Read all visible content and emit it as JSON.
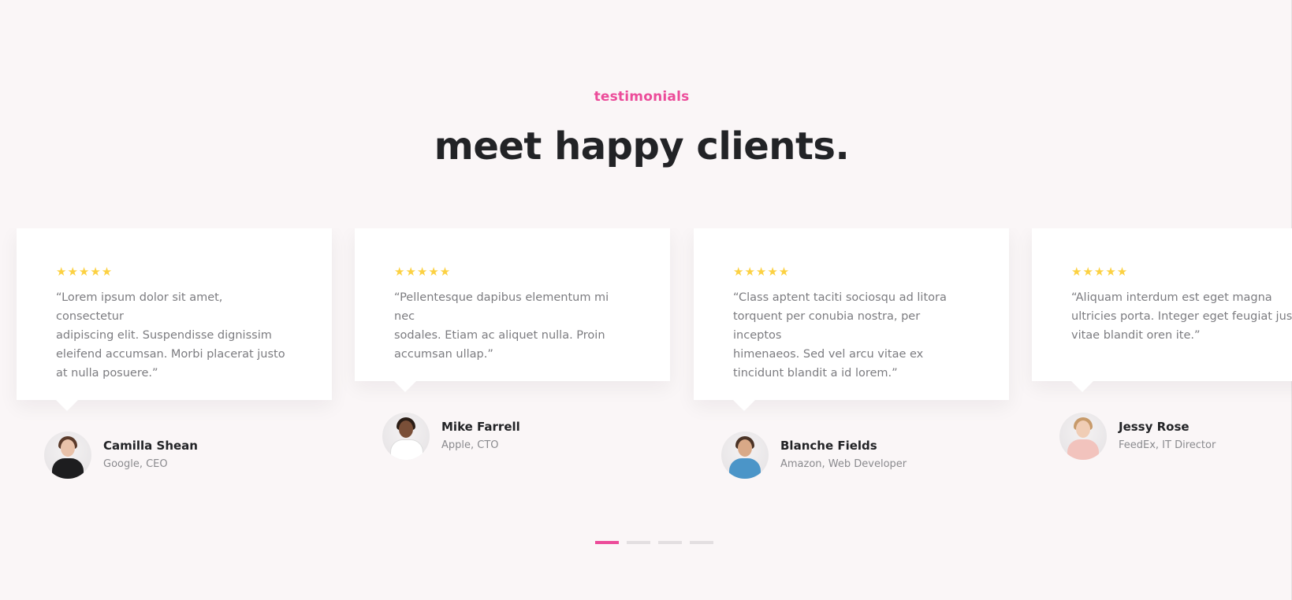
{
  "section": {
    "eyebrow": "testimonials",
    "headline": "meet happy clients."
  },
  "colors": {
    "accent": "#ec4c9a",
    "star": "#fcd142",
    "background": "#faf6f7"
  },
  "testimonials": [
    {
      "rating": "★★★★★",
      "quote": "“Lorem ipsum dolor sit amet, consectetur\nadipiscing elit. Suspendisse dignissim\neleifend accumsan. Morbi placerat justo\nat nulla posuere.”",
      "name": "Camilla Shean",
      "role": "Google, CEO",
      "avatar_icon": "avatar-woman-black-top"
    },
    {
      "rating": "★★★★★",
      "quote": "“Pellentesque dapibus elementum mi nec\nsodales. Etiam ac aliquet nulla. Proin\naccumsan ullap.”",
      "name": "Mike Farrell",
      "role": "Apple, CTO",
      "avatar_icon": "avatar-man-white-tee"
    },
    {
      "rating": "★★★★★",
      "quote": "“Class aptent taciti sociosqu ad litora\ntorquent per conubia nostra, per inceptos\nhimenaeos. Sed vel arcu vitae ex\ntincidunt  blandit a id lorem.”",
      "name": "Blanche Fields",
      "role": "Amazon, Web Developer",
      "avatar_icon": "avatar-man-denim-shirt"
    },
    {
      "rating": "★★★★★",
      "quote": "“Aliquam interdum est eget magna\nultricies porta. Integer eget feugiat justo\nvitae blandit oren ite.”",
      "name": "Jessy Rose",
      "role": "FeedEx, IT Director",
      "avatar_icon": "avatar-woman-pink-top"
    }
  ],
  "pagination": {
    "total": 4,
    "active": 1
  }
}
